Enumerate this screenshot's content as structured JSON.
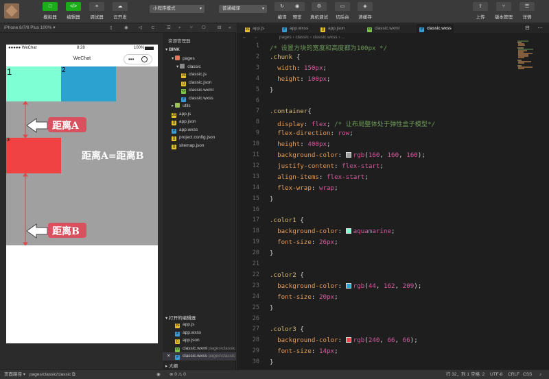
{
  "toolbar": {
    "buttons": [
      {
        "label": "模拟器",
        "icon": "□"
      },
      {
        "label": "编辑器",
        "icon": "</>"
      },
      {
        "label": "调试器",
        "icon": "≡"
      },
      {
        "label": "云开发",
        "icon": "☁"
      }
    ],
    "mode_select": "小程序模式",
    "compile_select": "普通编译",
    "actions": [
      {
        "label": "编译",
        "icon": "↻"
      },
      {
        "label": "预览",
        "icon": "◉"
      },
      {
        "label": "真机调试",
        "icon": "⚙"
      },
      {
        "label": "切后台",
        "icon": "▭"
      },
      {
        "label": "清缓存",
        "icon": "◈"
      }
    ],
    "right_actions": [
      {
        "label": "上传",
        "icon": "⇧"
      },
      {
        "label": "版本管理",
        "icon": "⑂"
      },
      {
        "label": "详情",
        "icon": "☰"
      }
    ]
  },
  "simulator": {
    "device": "iPhone 6/7/8 Plus 100% ▾",
    "status_left": "●●●●● WeChat",
    "status_time": "8:28",
    "status_battery": "100%",
    "nav_title": "WeChat",
    "capsule_dots": "•••",
    "box_labels": [
      "1",
      "2",
      "3"
    ],
    "distance_a": "距离A",
    "distance_b": "距离B",
    "equation": "距离A=距离B",
    "colors": {
      "aquamarine": "#7fffd4",
      "blue": "#2ca2d1",
      "red": "#f04242",
      "gray": "#a0a0a0"
    }
  },
  "explorer": {
    "title": "资源管理器",
    "root": "BINK",
    "items": [
      {
        "name": "pages",
        "indent": 1,
        "icon": "folder-red",
        "arrow": "▾"
      },
      {
        "name": "classic",
        "indent": 2,
        "icon": "folder",
        "arrow": "▾"
      },
      {
        "name": "classic.js",
        "indent": 3,
        "icon": "js"
      },
      {
        "name": "classic.json",
        "indent": 3,
        "icon": "json"
      },
      {
        "name": "classic.wxml",
        "indent": 3,
        "icon": "wxml"
      },
      {
        "name": "classic.wxss",
        "indent": 3,
        "icon": "wxss"
      },
      {
        "name": "utils",
        "indent": 1,
        "icon": "folder-green",
        "arrow": "▸"
      },
      {
        "name": "app.js",
        "indent": 1,
        "icon": "js"
      },
      {
        "name": "app.json",
        "indent": 1,
        "icon": "json"
      },
      {
        "name": "app.wxss",
        "indent": 1,
        "icon": "wxss"
      },
      {
        "name": "project.config.json",
        "indent": 1,
        "icon": "json"
      },
      {
        "name": "sitemap.json",
        "indent": 1,
        "icon": "json"
      }
    ],
    "open_editors_title": "打开的编辑器",
    "open_editors": [
      {
        "name": "app.js",
        "icon": "js",
        "path": ""
      },
      {
        "name": "app.wxss",
        "icon": "wxss",
        "path": ""
      },
      {
        "name": "app.json",
        "icon": "json",
        "path": ""
      },
      {
        "name": "classic.wxml",
        "icon": "wxml",
        "path": "pages\\classic"
      },
      {
        "name": "classic.wxss",
        "icon": "wxss",
        "path": "pages\\classic"
      }
    ],
    "outline_title": "大纲"
  },
  "editor": {
    "tabs": [
      {
        "name": "app.js",
        "icon": "js"
      },
      {
        "name": "app.wxss",
        "icon": "wxss"
      },
      {
        "name": "app.json",
        "icon": "json"
      },
      {
        "name": "classic.wxml",
        "icon": "wxml"
      },
      {
        "name": "classic.wxss",
        "icon": "wxss"
      }
    ],
    "breadcrumb": "pages  ›  classic  ›  classic.wxss  ›  ...",
    "lines": [
      [
        {
          "t": "/* 设置方块的宽度和高度都为100px */",
          "c": "com"
        }
      ],
      [
        {
          "t": ".chunk",
          "c": "sel"
        },
        {
          "t": " {",
          "c": "pun"
        }
      ],
      [
        {
          "t": "  width",
          "c": "prop"
        },
        {
          "t": ": ",
          "c": "pun"
        },
        {
          "t": "150px",
          "c": "val"
        },
        {
          "t": ";",
          "c": "pun"
        }
      ],
      [
        {
          "t": "  height",
          "c": "prop"
        },
        {
          "t": ": ",
          "c": "pun"
        },
        {
          "t": "100px",
          "c": "val"
        },
        {
          "t": ";",
          "c": "pun"
        }
      ],
      [
        {
          "t": "}",
          "c": "pun"
        }
      ],
      [],
      [
        {
          "t": ".container",
          "c": "sel"
        },
        {
          "t": "{",
          "c": "pun"
        }
      ],
      [
        {
          "t": "  display",
          "c": "prop"
        },
        {
          "t": ": ",
          "c": "pun"
        },
        {
          "t": "flex",
          "c": "kw"
        },
        {
          "t": "; ",
          "c": "pun"
        },
        {
          "t": "/* 让布局整体处于弹性盒子模型*/",
          "c": "com"
        }
      ],
      [
        {
          "t": "  flex-direction",
          "c": "prop"
        },
        {
          "t": ": ",
          "c": "pun"
        },
        {
          "t": "row",
          "c": "kw"
        },
        {
          "t": ";",
          "c": "pun"
        }
      ],
      [
        {
          "t": "  height",
          "c": "prop"
        },
        {
          "t": ": ",
          "c": "pun"
        },
        {
          "t": "400px",
          "c": "val"
        },
        {
          "t": ";",
          "c": "pun"
        }
      ],
      [
        {
          "t": "  background-color",
          "c": "prop"
        },
        {
          "t": ": ",
          "c": "pun"
        },
        {
          "sw": "#a0a0a0"
        },
        {
          "t": "rgb",
          "c": "kw"
        },
        {
          "t": "(",
          "c": "pun"
        },
        {
          "t": "160",
          "c": "val"
        },
        {
          "t": ", ",
          "c": "pun"
        },
        {
          "t": "160",
          "c": "val"
        },
        {
          "t": ", ",
          "c": "pun"
        },
        {
          "t": "160",
          "c": "val"
        },
        {
          "t": ");",
          "c": "pun"
        }
      ],
      [
        {
          "t": "  justify-content",
          "c": "prop"
        },
        {
          "t": ": ",
          "c": "pun"
        },
        {
          "t": "flex-start",
          "c": "kw"
        },
        {
          "t": ";",
          "c": "pun"
        }
      ],
      [
        {
          "t": "  align-items",
          "c": "prop"
        },
        {
          "t": ": ",
          "c": "pun"
        },
        {
          "t": "flex-start",
          "c": "kw"
        },
        {
          "t": ";",
          "c": "pun"
        }
      ],
      [
        {
          "t": "  flex-wrap",
          "c": "prop"
        },
        {
          "t": ": ",
          "c": "pun"
        },
        {
          "t": "wrap",
          "c": "kw"
        },
        {
          "t": ";",
          "c": "pun"
        }
      ],
      [
        {
          "t": "}",
          "c": "pun"
        }
      ],
      [],
      [
        {
          "t": ".color1",
          "c": "sel"
        },
        {
          "t": " {",
          "c": "pun"
        }
      ],
      [
        {
          "t": "  background-color",
          "c": "prop"
        },
        {
          "t": ": ",
          "c": "pun"
        },
        {
          "sw": "#7fffd4"
        },
        {
          "t": "aquamarine",
          "c": "kw"
        },
        {
          "t": ";",
          "c": "pun"
        }
      ],
      [
        {
          "t": "  font-size",
          "c": "prop"
        },
        {
          "t": ": ",
          "c": "pun"
        },
        {
          "t": "26px",
          "c": "val"
        },
        {
          "t": ";",
          "c": "pun"
        }
      ],
      [
        {
          "t": "}",
          "c": "pun"
        }
      ],
      [],
      [
        {
          "t": ".color2",
          "c": "sel"
        },
        {
          "t": " {",
          "c": "pun"
        }
      ],
      [
        {
          "t": "  background-color",
          "c": "prop"
        },
        {
          "t": ": ",
          "c": "pun"
        },
        {
          "sw": "#2ca2d1"
        },
        {
          "t": "rgb",
          "c": "kw"
        },
        {
          "t": "(",
          "c": "pun"
        },
        {
          "t": "44",
          "c": "val"
        },
        {
          "t": ", ",
          "c": "pun"
        },
        {
          "t": "162",
          "c": "val"
        },
        {
          "t": ", ",
          "c": "pun"
        },
        {
          "t": "209",
          "c": "val"
        },
        {
          "t": ");",
          "c": "pun"
        }
      ],
      [
        {
          "t": "  font-size",
          "c": "prop"
        },
        {
          "t": ": ",
          "c": "pun"
        },
        {
          "t": "20px",
          "c": "val"
        },
        {
          "t": ";",
          "c": "pun"
        }
      ],
      [
        {
          "t": "}",
          "c": "pun"
        }
      ],
      [],
      [
        {
          "t": ".color3",
          "c": "sel"
        },
        {
          "t": " {",
          "c": "pun"
        }
      ],
      [
        {
          "t": "  background-color",
          "c": "prop"
        },
        {
          "t": ": ",
          "c": "pun"
        },
        {
          "sw": "#f04242"
        },
        {
          "t": "rgb",
          "c": "kw"
        },
        {
          "t": "(",
          "c": "pun"
        },
        {
          "t": "240",
          "c": "val"
        },
        {
          "t": ", ",
          "c": "pun"
        },
        {
          "t": "66",
          "c": "val"
        },
        {
          "t": ", ",
          "c": "pun"
        },
        {
          "t": "66",
          "c": "val"
        },
        {
          "t": ");",
          "c": "pun"
        }
      ],
      [
        {
          "t": "  font-size",
          "c": "prop"
        },
        {
          "t": ": ",
          "c": "pun"
        },
        {
          "t": "14px",
          "c": "val"
        },
        {
          "t": ";",
          "c": "pun"
        }
      ],
      [
        {
          "t": "}",
          "c": "pun"
        }
      ]
    ]
  },
  "statusbar": {
    "page_path_label": "页面路径 ▾",
    "page_path": "pages/classic/classic",
    "errors": "⊗ 0 ⚠ 0",
    "position": "行 32，列 1",
    "spaces": "空格: 2",
    "encoding": "UTF-8",
    "eol": "CRLF",
    "language": "CSS"
  },
  "syntax_colors": {
    "com": "#6a9955",
    "sel": "#d7ba7d",
    "prop": "#e59d5b",
    "val": "#d35d9e",
    "kw": "#d35d9e",
    "pun": "#d4d4d4"
  }
}
